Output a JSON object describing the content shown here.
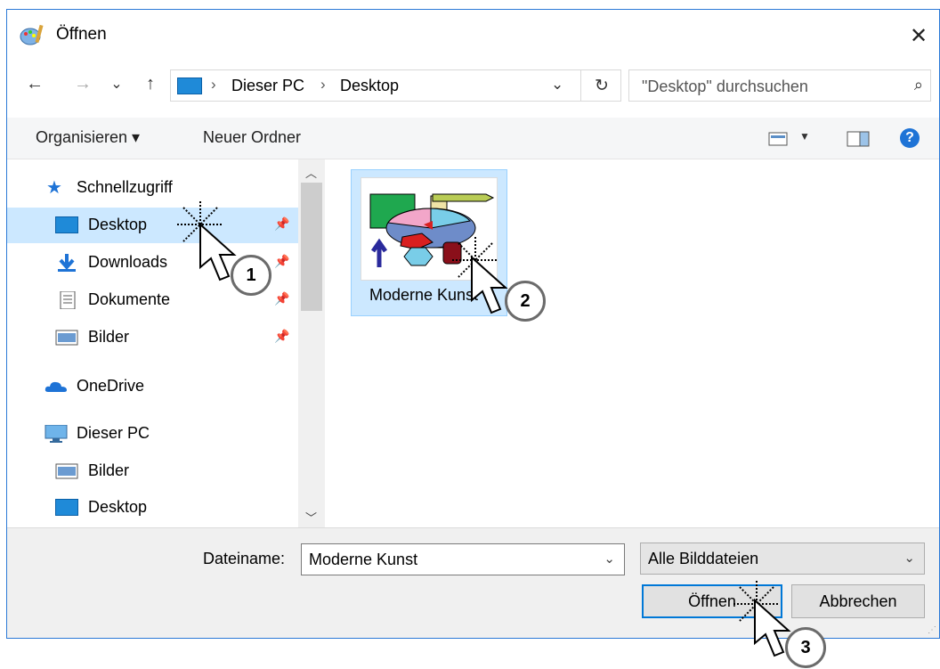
{
  "titlebar": {
    "title": "Öffnen",
    "close": "✕"
  },
  "nav": {
    "back": "←",
    "forward": "→",
    "recent": "⌄",
    "up": "↑",
    "crumbs": [
      "Dieser PC",
      "Desktop"
    ],
    "separator": "›",
    "dropdown": "⌄",
    "refresh": "↻",
    "search_placeholder": "\"Desktop\" durchsuchen",
    "search_icon": "⌕"
  },
  "commands": {
    "organize": "Organisieren ▾",
    "new_folder": "Neuer Ordner",
    "help": "?"
  },
  "sidebar": {
    "quick_access": "Schnellzugriff",
    "items": [
      {
        "label": "Desktop",
        "icon": "desktop-icon"
      },
      {
        "label": "Downloads",
        "icon": "download-icon"
      },
      {
        "label": "Dokumente",
        "icon": "document-icon"
      },
      {
        "label": "Bilder",
        "icon": "pictures-icon"
      }
    ],
    "onedrive": "OneDrive",
    "this_pc": "Dieser PC",
    "pc_items": [
      {
        "label": "Bilder",
        "icon": "pictures-icon"
      },
      {
        "label": "Desktop",
        "icon": "desktop-icon"
      }
    ],
    "pin": "📌"
  },
  "files": [
    {
      "name": "Moderne Kunst"
    }
  ],
  "bottom": {
    "filename_label": "Dateiname:",
    "filename_value": "Moderne Kunst",
    "filetype_value": "Alle Bilddateien",
    "open_button": "Öffnen",
    "cancel_button": "Abbrechen"
  },
  "callouts": [
    "1",
    "2",
    "3"
  ],
  "colors": {
    "accent": "#0078d7",
    "selection": "#cce8ff",
    "border": "#2b79d7"
  }
}
